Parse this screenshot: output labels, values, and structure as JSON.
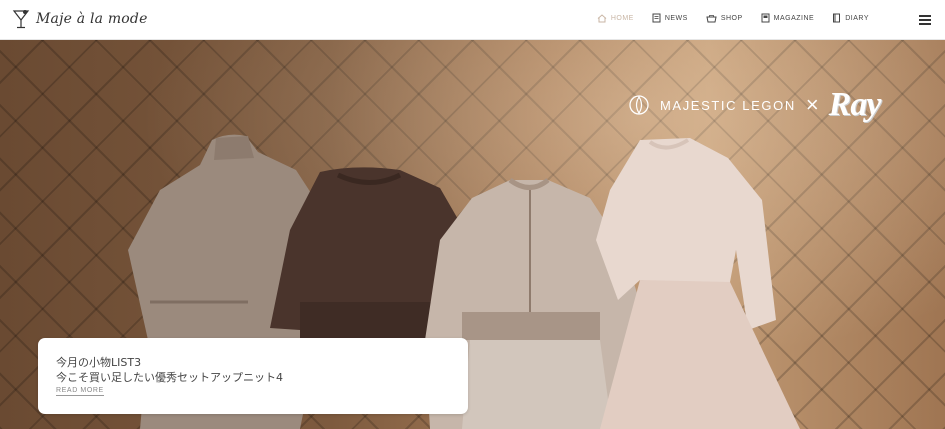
{
  "header": {
    "logo_text": "Maje à la mode",
    "nav": [
      {
        "label": "HOME",
        "icon": "home-icon",
        "active": true
      },
      {
        "label": "NEWS",
        "icon": "news-icon",
        "active": false
      },
      {
        "label": "SHOP",
        "icon": "shop-icon",
        "active": false
      },
      {
        "label": "MAGAZINE",
        "icon": "magazine-icon",
        "active": false
      },
      {
        "label": "DIARY",
        "icon": "diary-icon",
        "active": false
      }
    ],
    "menu_icon": "hamburger-menu-icon"
  },
  "hero": {
    "collab_brand": "MAJESTIC LEGON",
    "collab_x": "×",
    "collab_partner": "Ray"
  },
  "card": {
    "line1": "今月の小物LIST3",
    "line2": "今こそ買い足したい優秀セットアップニット4",
    "read_more": "READ MORE"
  },
  "colors": {
    "active_nav": "#c9b6a5",
    "text": "#444444",
    "card_bg": "#ffffff"
  }
}
